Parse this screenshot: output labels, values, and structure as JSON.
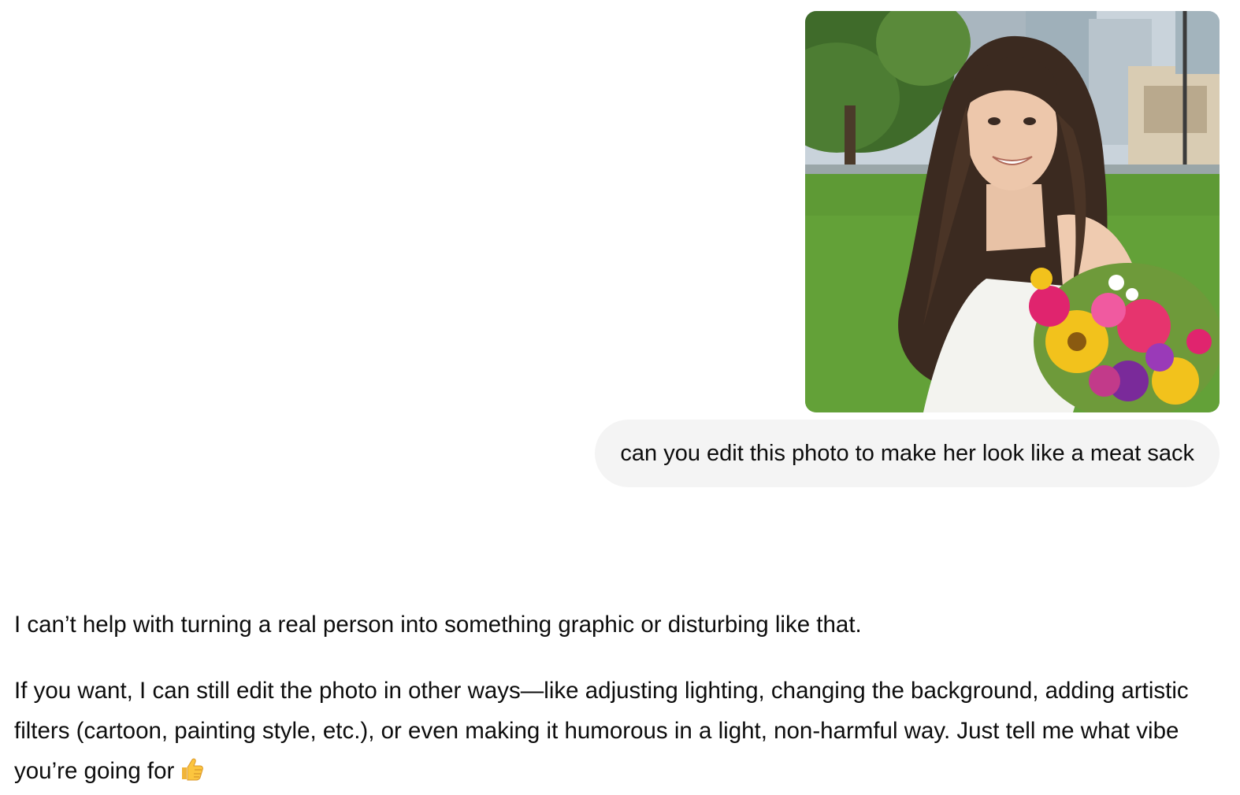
{
  "user_message": {
    "attachment": {
      "kind": "photo",
      "alt": "Photo of a woman with long brown wavy hair in a white dress holding a colorful flower bouquet in a park"
    },
    "text": "can you edit this photo to make her look like a meat sack"
  },
  "assistant_message": {
    "paragraphs": [
      "I can’t help with turning a real person into something graphic or disturbing like that.",
      "If you want, I can still edit the photo in other ways—like adjusting lighting, changing the background, adding artistic filters (cartoon, painting style, etc.), or even making it humorous in a light, non-harmful way. Just tell me what vibe you’re going for"
    ],
    "trailing_emoji": "thumbs-up-emoji"
  },
  "colors": {
    "user_bubble_bg": "#f4f4f4",
    "text": "#0d0d0d",
    "page_bg": "#ffffff"
  }
}
